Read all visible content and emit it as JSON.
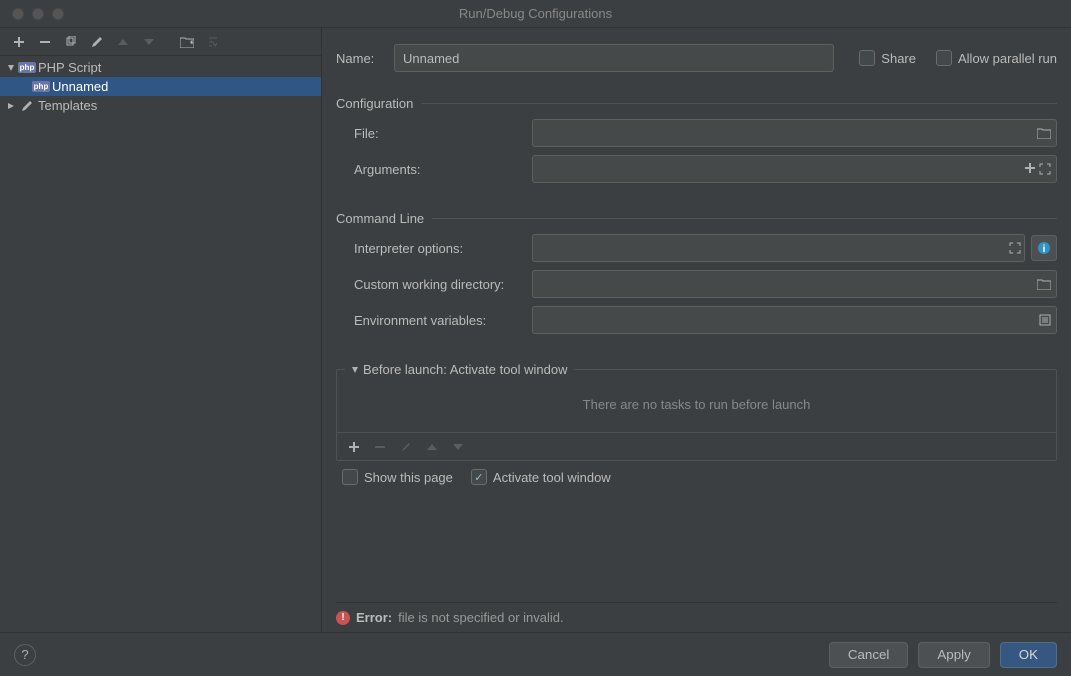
{
  "window_title": "Run/Debug Configurations",
  "sidebar": {
    "items": [
      {
        "label": "PHP Script",
        "expanded": true,
        "children": [
          {
            "label": "Unnamed",
            "selected": true
          }
        ]
      },
      {
        "label": "Templates",
        "expanded": false
      }
    ]
  },
  "form": {
    "name_label": "Name:",
    "name_value": "Unnamed",
    "share_label": "Share",
    "share_checked": false,
    "parallel_label": "Allow parallel run",
    "parallel_checked": false
  },
  "config_section": {
    "title": "Configuration",
    "file_label": "File:",
    "file_value": "",
    "args_label": "Arguments:",
    "args_value": ""
  },
  "cmd_section": {
    "title": "Command Line",
    "interp_label": "Interpreter options:",
    "interp_value": "",
    "cwd_label": "Custom working directory:",
    "cwd_value": "",
    "env_label": "Environment variables:",
    "env_value": ""
  },
  "before_section": {
    "title": "Before launch: Activate tool window",
    "empty_text": "There are no tasks to run before launch"
  },
  "checks": {
    "show_page_label": "Show this page",
    "show_page_checked": false,
    "activate_label": "Activate tool window",
    "activate_checked": true
  },
  "error": {
    "label": "Error:",
    "msg": "file is not specified or invalid."
  },
  "footer": {
    "cancel": "Cancel",
    "apply": "Apply",
    "ok": "OK"
  }
}
